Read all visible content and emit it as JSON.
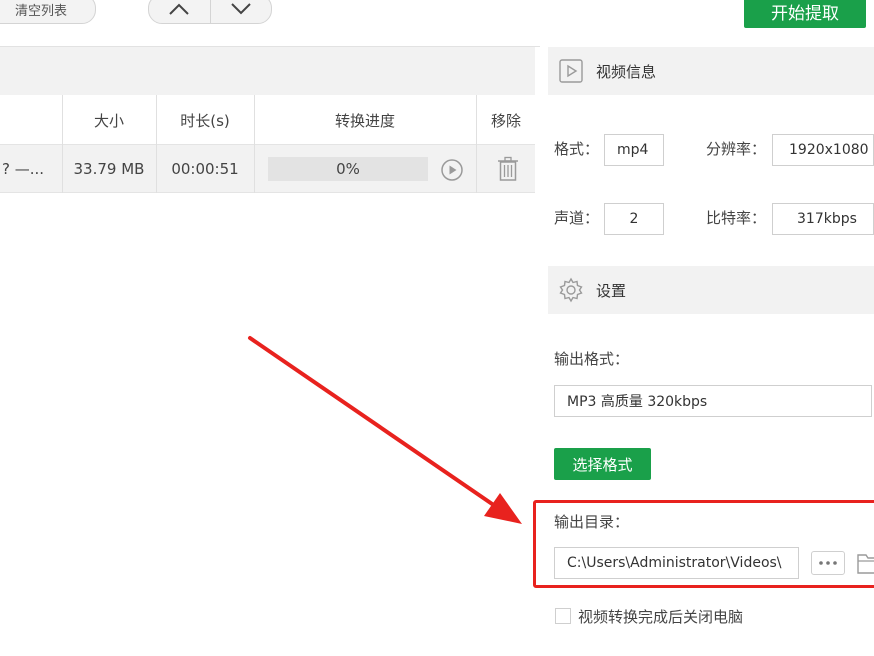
{
  "toolbar": {
    "clear_list_label": "清空列表",
    "start_extract_label": "开始提取",
    "up_icon": "chevron-up-icon",
    "down_icon": "chevron-down-icon"
  },
  "file_table": {
    "columns": [
      "大小",
      "时长(s)",
      "转换进度",
      "移除"
    ],
    "rows": [
      {
        "name": "? —...",
        "size": "33.79 MB",
        "duration": "00:00:51",
        "progress": 0,
        "progress_text": "0%",
        "play_icon": "play-icon",
        "remove_icon": "trash-icon"
      }
    ]
  },
  "video_info": {
    "title": "视频信息",
    "icon": "video-icon",
    "format_label": "格式：",
    "format_value": "mp4",
    "resolution_label": "分辨率：",
    "resolution_value": "1920x1080",
    "channels_label": "声道：",
    "channels_value": "2",
    "bitrate_label": "比特率：",
    "bitrate_value": "317kbps"
  },
  "settings": {
    "title": "设置",
    "icon": "gear-icon",
    "output_format_label": "输出格式：",
    "output_format_value": "MP3 高质量 320kbps",
    "choose_format_label": "选择格式",
    "output_dir_label": "输出目录：",
    "output_dir_value": "C:\\Users\\Administrator\\Videos\\",
    "browse_icon": "more-icon",
    "folder_icon": "folder-icon",
    "shutdown_label": "视频转换完成后关闭电脑",
    "shutdown_checked": false
  },
  "colors": {
    "accent_green": "#1aa04a",
    "highlight_red": "#e8221e"
  }
}
